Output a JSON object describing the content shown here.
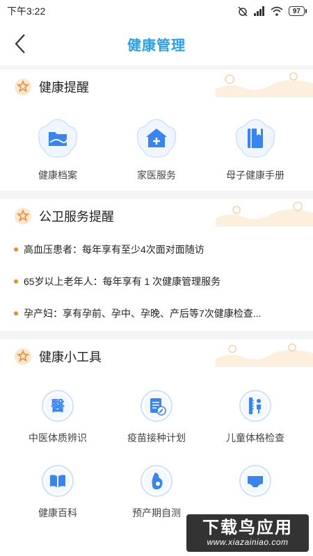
{
  "status_bar": {
    "time": "下午3:22",
    "battery": "97"
  },
  "header": {
    "title": "健康管理"
  },
  "health_reminder": {
    "title": "健康提醒",
    "items": [
      {
        "label": "健康档案",
        "icon": "folder-icon"
      },
      {
        "label": "家医服务",
        "icon": "home-plus-icon"
      },
      {
        "label": "母子健康手册",
        "icon": "book-icon"
      }
    ]
  },
  "public_service": {
    "title": "公卫服务提醒",
    "items": [
      "高血压患者：每年享有至少4次面对面随访",
      "65岁以上老年人：每年享有 1 次健康管理服务",
      "孕产妇：享有孕前、孕中、孕晚、产后等7次健康检查..."
    ]
  },
  "health_tools": {
    "title": "健康小工具",
    "items": [
      {
        "label": "中医体质辨识",
        "icon": "medicine-char-icon"
      },
      {
        "label": "疫苗接种计划",
        "icon": "document-edit-icon"
      },
      {
        "label": "儿童体格检查",
        "icon": "child-height-icon"
      },
      {
        "label": "健康百科",
        "icon": "open-book-icon"
      },
      {
        "label": "预产期自测",
        "icon": "pregnancy-icon"
      },
      {
        "label": "",
        "icon": "underwear-icon"
      }
    ]
  },
  "watermark": {
    "main": "下载鸟应用",
    "url": "www.xiazainiao.com"
  },
  "colors": {
    "accent": "#2aa0e8",
    "icon_blue": "#3a84f0",
    "dot_orange": "#f08a2c"
  }
}
